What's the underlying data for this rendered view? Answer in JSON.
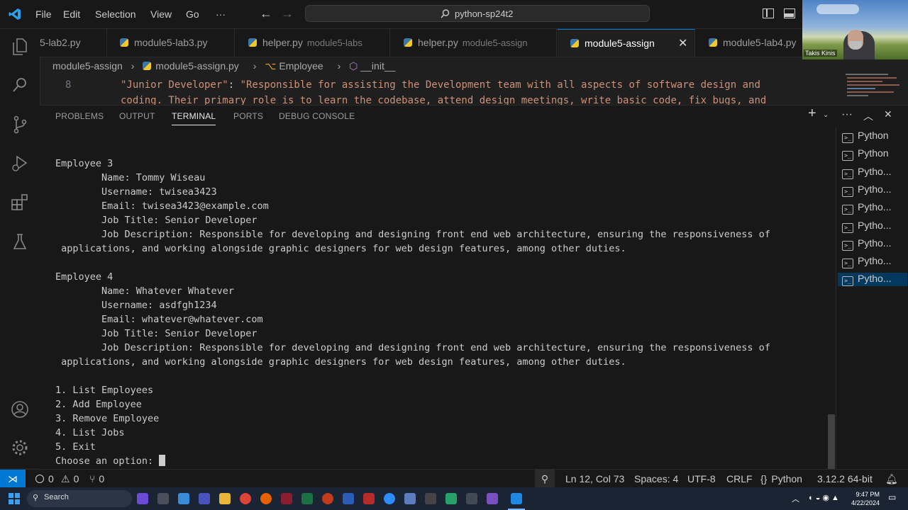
{
  "titlebar": {
    "menus": [
      "File",
      "Edit",
      "Selection",
      "View",
      "Go",
      "···"
    ],
    "search_text": "python-sp24t2"
  },
  "webcam": {
    "name": "Takis Kinis"
  },
  "tabs": [
    {
      "label": "5-lab2.py",
      "desc": ""
    },
    {
      "label": "module5-lab3.py",
      "desc": ""
    },
    {
      "label": "helper.py",
      "desc": "module5-labs"
    },
    {
      "label": "helper.py",
      "desc": "module5-assign"
    },
    {
      "label": "module5-assign",
      "desc": "",
      "active": true
    },
    {
      "label": "module5-lab4.py",
      "desc": ""
    }
  ],
  "breadcrumb": [
    "module5-assign",
    "›",
    "module5-assign.py",
    "›",
    "Employee",
    "›",
    "__init__"
  ],
  "editor": {
    "line_number": "8",
    "line1_key": "\"Junior Developer\"",
    "line1_colon": ": ",
    "line1_value": "\"Responsible for assisting the Development team with all aspects of software design and",
    "line2_value": "coding. Their primary role is to learn the codebase, attend design meetings, write basic code, fix bugs, and"
  },
  "panel": {
    "tabs": [
      "PROBLEMS",
      "OUTPUT",
      "TERMINAL",
      "PORTS",
      "DEBUG CONSOLE"
    ],
    "active_tab": "TERMINAL"
  },
  "terminal_lines": [
    "Employee 3",
    "        Name: Tommy Wiseau",
    "        Username: twisea3423",
    "        Email: twisea3423@example.com",
    "        Job Title: Senior Developer",
    "        Job Description: Responsible for developing and designing front end web architecture, ensuring the responsiveness of",
    " applications, and working alongside graphic designers for web design features, among other duties.",
    "",
    "Employee 4",
    "        Name: Whatever Whatever",
    "        Username: asdfgh1234",
    "        Email: whatever@whatever.com",
    "        Job Title: Senior Developer",
    "        Job Description: Responsible for developing and designing front end web architecture, ensuring the responsiveness of",
    " applications, and working alongside graphic designers for web design features, among other duties.",
    "",
    "1. List Employees",
    "2. Add Employee",
    "3. Remove Employee",
    "4. List Jobs",
    "5. Exit"
  ],
  "prompt": "Choose an option: ",
  "terminal_list": [
    "Python",
    "Python",
    "Pytho...",
    "Pytho...",
    "Pytho...",
    "Pytho...",
    "Pytho...",
    "Pytho...",
    "Pytho..."
  ],
  "statusbar": {
    "errors": "0",
    "warnings": "0",
    "ports": "0",
    "position": "Ln 12, Col 73",
    "spaces": "Spaces: 4",
    "encoding": "UTF-8",
    "eol": "CRLF",
    "language": "Python",
    "interpreter": "3.12.2 64-bit"
  },
  "taskbar": {
    "search": "Search",
    "time": "9:47 PM",
    "date": "4/22/2024"
  },
  "colors": {
    "accent": "#0078d4",
    "string": "#ce9178",
    "key": "#ce9178"
  }
}
